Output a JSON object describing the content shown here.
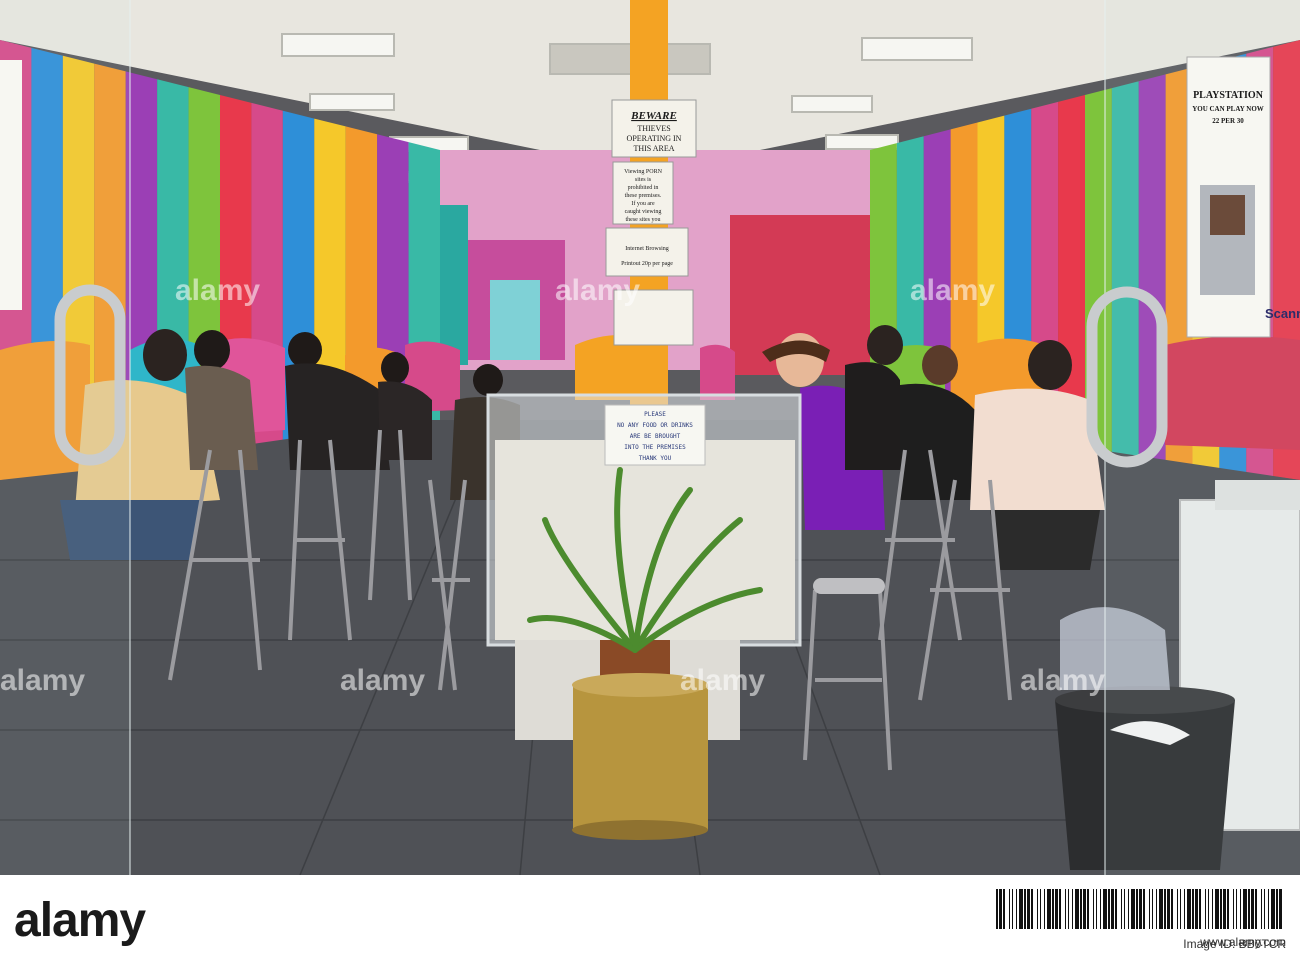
{
  "scene": {
    "description_hidden": ""
  },
  "signs": {
    "beware_title": "BEWARE",
    "beware_line1": "THIEVES",
    "beware_line2": "OPERATING IN",
    "beware_line3": "THIS AREA",
    "porn_lines": [
      "Viewing PORN",
      "sites is",
      "prohibited in",
      "these premises.",
      "If you are",
      "caught viewing",
      "these sites you"
    ],
    "prices_line1": "Internet Browsing",
    "prices_line2": "Printout 20p per page",
    "playstation_title": "PLAYSTATION",
    "playstation_line1": "YOU CAN PLAY NOW",
    "playstation_line2": "22 PER 30",
    "food_note_lines": [
      "PLEASE",
      "NO ANY FOOD OR DRINKS",
      "ARE BE BROUGHT",
      "INTO THE PREMISES",
      "THANK YOU"
    ],
    "scanner": "Scanner"
  },
  "watermark": {
    "text": "alamy"
  },
  "footer": {
    "logo": "alamy",
    "image_id_label": "Image ID: BB0TCR",
    "site": "www.alamy.com"
  },
  "colors": {
    "stripes": [
      "#d64a8a",
      "#f39a2c",
      "#7ec43c",
      "#2e8fd8",
      "#9b3fb5",
      "#e8394c",
      "#f5c82a",
      "#39b9a6"
    ],
    "pillar": "#f4a323",
    "floor": "#4f5156"
  }
}
